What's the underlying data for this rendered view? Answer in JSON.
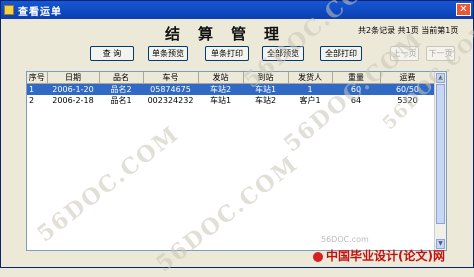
{
  "window": {
    "title": "查看运单"
  },
  "header": {
    "title": "结算管理",
    "record_info": "共2条记录 共1页 当前第1页"
  },
  "toolbar": {
    "query": "查  询",
    "single_preview": "单条预览",
    "single_print": "单条打印",
    "all_preview": "全部预览",
    "all_print": "全部打印",
    "prev_page": "上一页",
    "next_page": "下一页"
  },
  "table": {
    "columns": [
      "序号",
      "日期",
      "品名",
      "车号",
      "发站",
      "到站",
      "发货人",
      "重量",
      "运费"
    ],
    "rows": [
      [
        "1",
        "2006-1-20",
        "品名2",
        "05874675",
        "车站2",
        "车站1",
        "1",
        "60",
        "60/50"
      ],
      [
        "2",
        "2006-2-18",
        "品名1",
        "002324232",
        "车站1",
        "车站2",
        "客户1",
        "64",
        "5320"
      ]
    ]
  },
  "watermarks": [
    "56DOC.COM",
    "56DOC.COM",
    "56DOC.COM",
    "56DOC.COM",
    "56DOC.COM"
  ],
  "footer": {
    "brand": "56DOC.com",
    "site": "中国毕业设计(论文)网"
  }
}
